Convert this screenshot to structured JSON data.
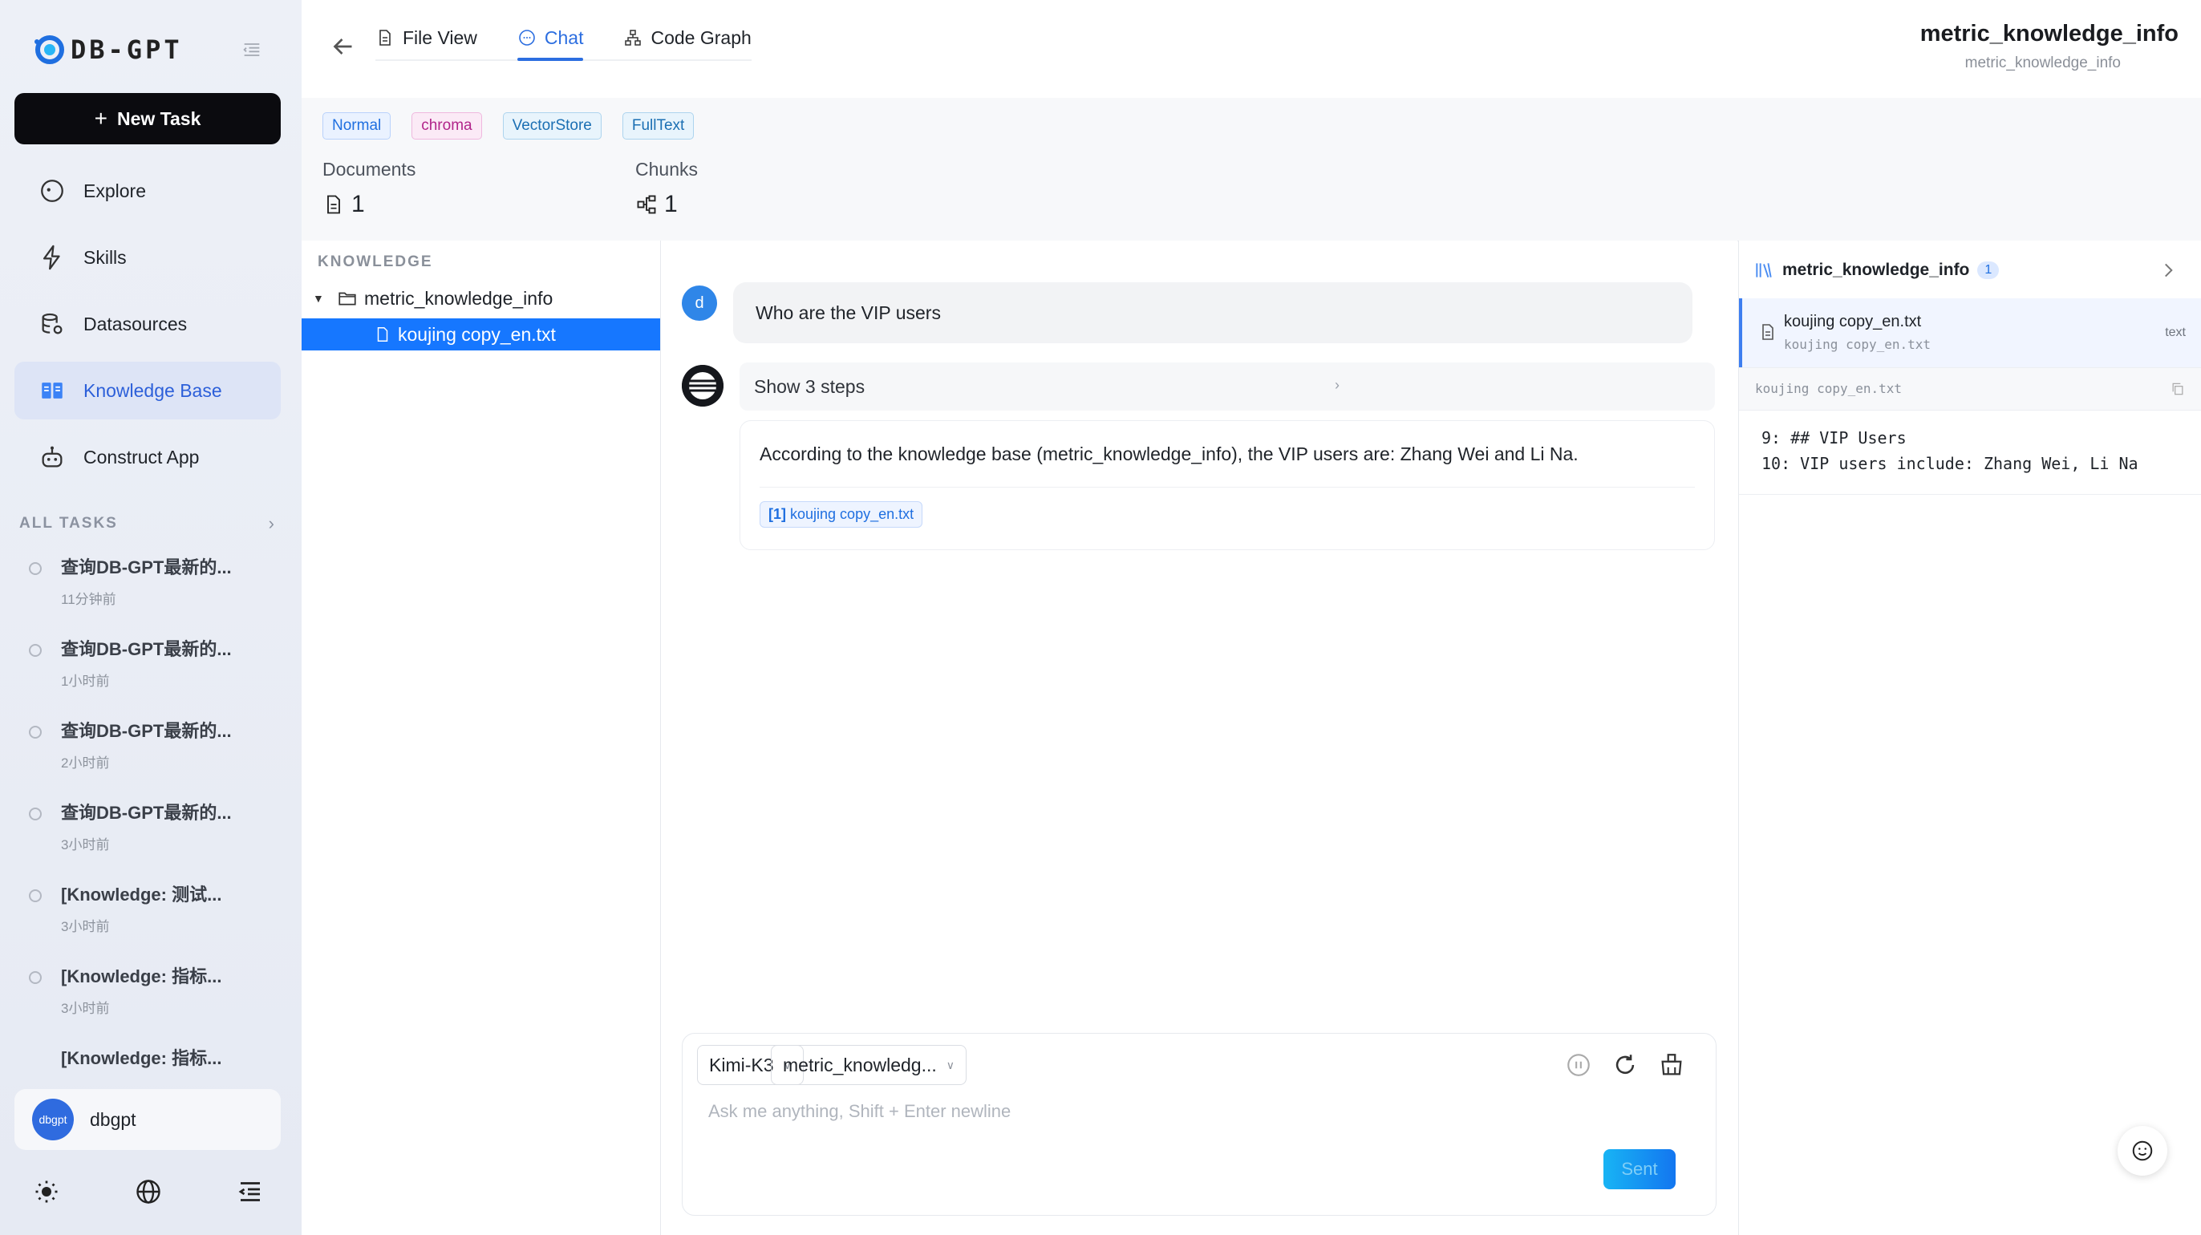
{
  "sidebar": {
    "logo_text": "DB-GPT",
    "new_task": "New Task",
    "nav": [
      {
        "label": "Explore",
        "icon": "compass-icon"
      },
      {
        "label": "Skills",
        "icon": "lightning-icon"
      },
      {
        "label": "Datasources",
        "icon": "database-icon"
      },
      {
        "label": "Knowledge Base",
        "icon": "book-icon",
        "active": true
      },
      {
        "label": "Construct App",
        "icon": "robot-icon"
      }
    ],
    "all_tasks": "ALL TASKS",
    "tasks": [
      {
        "title": "查询DB-GPT最新的...",
        "time": "11分钟前"
      },
      {
        "title": "查询DB-GPT最新的...",
        "time": "1小时前"
      },
      {
        "title": "查询DB-GPT最新的...",
        "time": "2小时前"
      },
      {
        "title": "查询DB-GPT最新的...",
        "time": "3小时前"
      },
      {
        "title": "[Knowledge: 测试...",
        "time": "3小时前"
      },
      {
        "title": "[Knowledge: 指标...",
        "time": "3小时前"
      },
      {
        "title": "[Knowledge: 指标...",
        "time": ""
      }
    ],
    "user": {
      "avatar_text": "dbgpt",
      "name": "dbgpt"
    }
  },
  "header": {
    "tabs": [
      {
        "label": "File View",
        "icon": "file-icon"
      },
      {
        "label": "Chat",
        "icon": "chat-icon",
        "active": true
      },
      {
        "label": "Code Graph",
        "icon": "graph-icon"
      }
    ],
    "title": "metric_knowledge_info",
    "subtitle": "metric_knowledge_info"
  },
  "meta": {
    "tags": [
      "Normal",
      "chroma",
      "VectorStore",
      "FullText"
    ],
    "documents_label": "Documents",
    "documents_value": "1",
    "chunks_label": "Chunks",
    "chunks_value": "1"
  },
  "tree": {
    "heading": "KNOWLEDGE",
    "folder": "metric_knowledge_info",
    "file": "koujing copy_en.txt"
  },
  "chat": {
    "user_avatar": "d",
    "question": "Who are the VIP users",
    "steps": "Show 3 steps",
    "answer": "According to the knowledge base (metric_knowledge_info), the VIP users are: Zhang Wei and Li Na.",
    "citation_index": "[1]",
    "citation_file": "koujing copy_en.txt",
    "model": "Kimi-K3",
    "knowledge_select": "metric_knowledg...",
    "placeholder": "Ask me anything, Shift + Enter newline",
    "send": "Sent"
  },
  "references": {
    "title": "metric_knowledge_info",
    "count": "1",
    "item_name": "koujing copy_en.txt",
    "item_sub": "koujing copy_en.txt",
    "item_type": "text",
    "file_label": "koujing copy_en.txt",
    "lines": [
      "9: ## VIP Users",
      "10: VIP users include: Zhang Wei, Li Na"
    ]
  },
  "colors": {
    "accent": "#2c6ee0",
    "primary_button": "#0b0b0f",
    "selected_file": "#1677ff"
  }
}
